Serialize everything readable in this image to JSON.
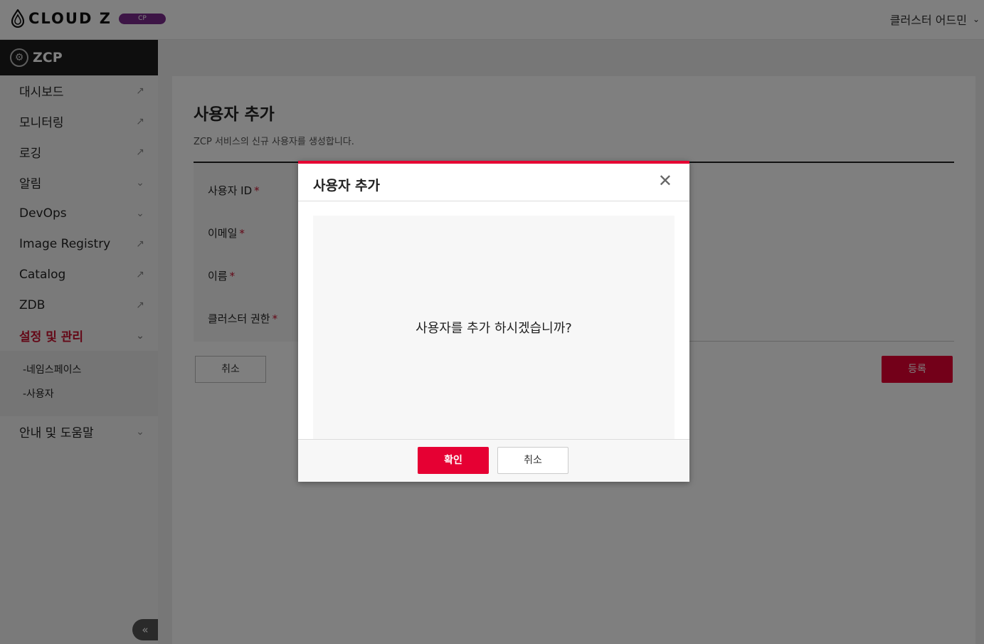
{
  "header": {
    "logo_text": "CLOUD Z",
    "logo_badge": "CP",
    "user_role": "클러스터 어드민"
  },
  "sidebar": {
    "title": "ZCP",
    "items": [
      {
        "label": "대시보드",
        "icon": "external-link-icon"
      },
      {
        "label": "모니터링",
        "icon": "external-link-icon"
      },
      {
        "label": "로깅",
        "icon": "external-link-icon"
      },
      {
        "label": "알림",
        "icon": "chevron-down-icon"
      },
      {
        "label": "DevOps",
        "icon": "chevron-down-icon"
      },
      {
        "label": "Image Registry",
        "icon": "external-link-icon"
      },
      {
        "label": "Catalog",
        "icon": "external-link-icon"
      },
      {
        "label": "ZDB",
        "icon": "external-link-icon"
      },
      {
        "label": "설정 및 관리",
        "icon": "chevron-down-icon"
      }
    ],
    "submenu": [
      "-네임스페이스",
      "-사용자"
    ],
    "help": {
      "label": "안내 및 도움말",
      "icon": "chevron-down-icon"
    }
  },
  "page": {
    "title": "사용자 추가",
    "description": "ZCP 서비스의 신규 사용자를 생성합니다.",
    "fields": [
      {
        "label": "사용자 ID",
        "required": "*"
      },
      {
        "label": "이메일",
        "required": "*"
      },
      {
        "label": "이름",
        "required": "*"
      },
      {
        "label": "클러스터 권한",
        "required": "*"
      }
    ],
    "cancel_label": "취소",
    "register_label": "등록"
  },
  "modal": {
    "title": "사용자 추가",
    "message": "사용자를 추가 하시겠습니까?",
    "confirm_label": "확인",
    "cancel_label": "취소"
  },
  "colors": {
    "accent": "#e60033",
    "active_menu": "#c8102e",
    "badge": "#7b2a8c",
    "sidebar_header": "#1c1c1c"
  }
}
